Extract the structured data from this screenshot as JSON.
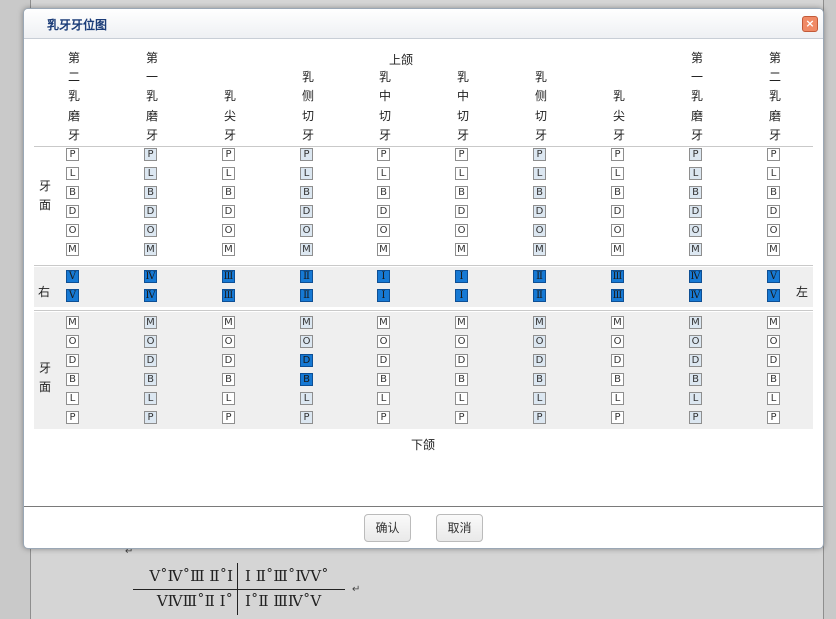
{
  "dialog": {
    "title": "乳牙牙位图",
    "close_icon": "×",
    "upper_jaw_label": "上颌",
    "lower_jaw_label": "下颌",
    "tooth_face_label": "牙面",
    "right_label": "右",
    "left_label": "左",
    "columns": [
      "第二乳磨牙",
      "第一乳磨牙",
      "乳尖牙",
      "乳侧切牙",
      "乳中切牙",
      "乳中切牙",
      "乳侧切牙",
      "乳尖牙",
      "第一乳磨牙",
      "第二乳磨牙"
    ],
    "upper_surfaces": [
      "P",
      "L",
      "B",
      "D",
      "O",
      "M"
    ],
    "lower_surfaces": [
      "M",
      "O",
      "D",
      "B",
      "L",
      "P"
    ],
    "tooth_numbers": [
      "Ⅴ",
      "Ⅳ",
      "Ⅲ",
      "Ⅱ",
      "Ⅰ",
      "Ⅰ",
      "Ⅱ",
      "Ⅲ",
      "Ⅳ",
      "Ⅴ"
    ],
    "selected_lower_surfaces_in_col_4": [
      "D",
      "B"
    ],
    "confirm_label": "确认",
    "cancel_label": "取消"
  },
  "document": {
    "upper_left_quadrant": "Ⅴ˚Ⅳ˚Ⅲ Ⅱ˚Ⅰ",
    "upper_right_quadrant": "Ⅰ Ⅱ˚Ⅲ˚ⅣⅤ˚",
    "lower_left_quadrant": "ⅤⅣⅢ˚Ⅱ Ⅰ˚",
    "lower_right_quadrant": "Ⅰ˚Ⅱ ⅢⅣ˚Ⅴ",
    "paragraph_mark": "↵"
  },
  "colors": {
    "selected_fill": "#1679d4",
    "shaded_fill": "#dce7f1",
    "title_text": "#1b3c78",
    "close_button": "#f08a66"
  }
}
